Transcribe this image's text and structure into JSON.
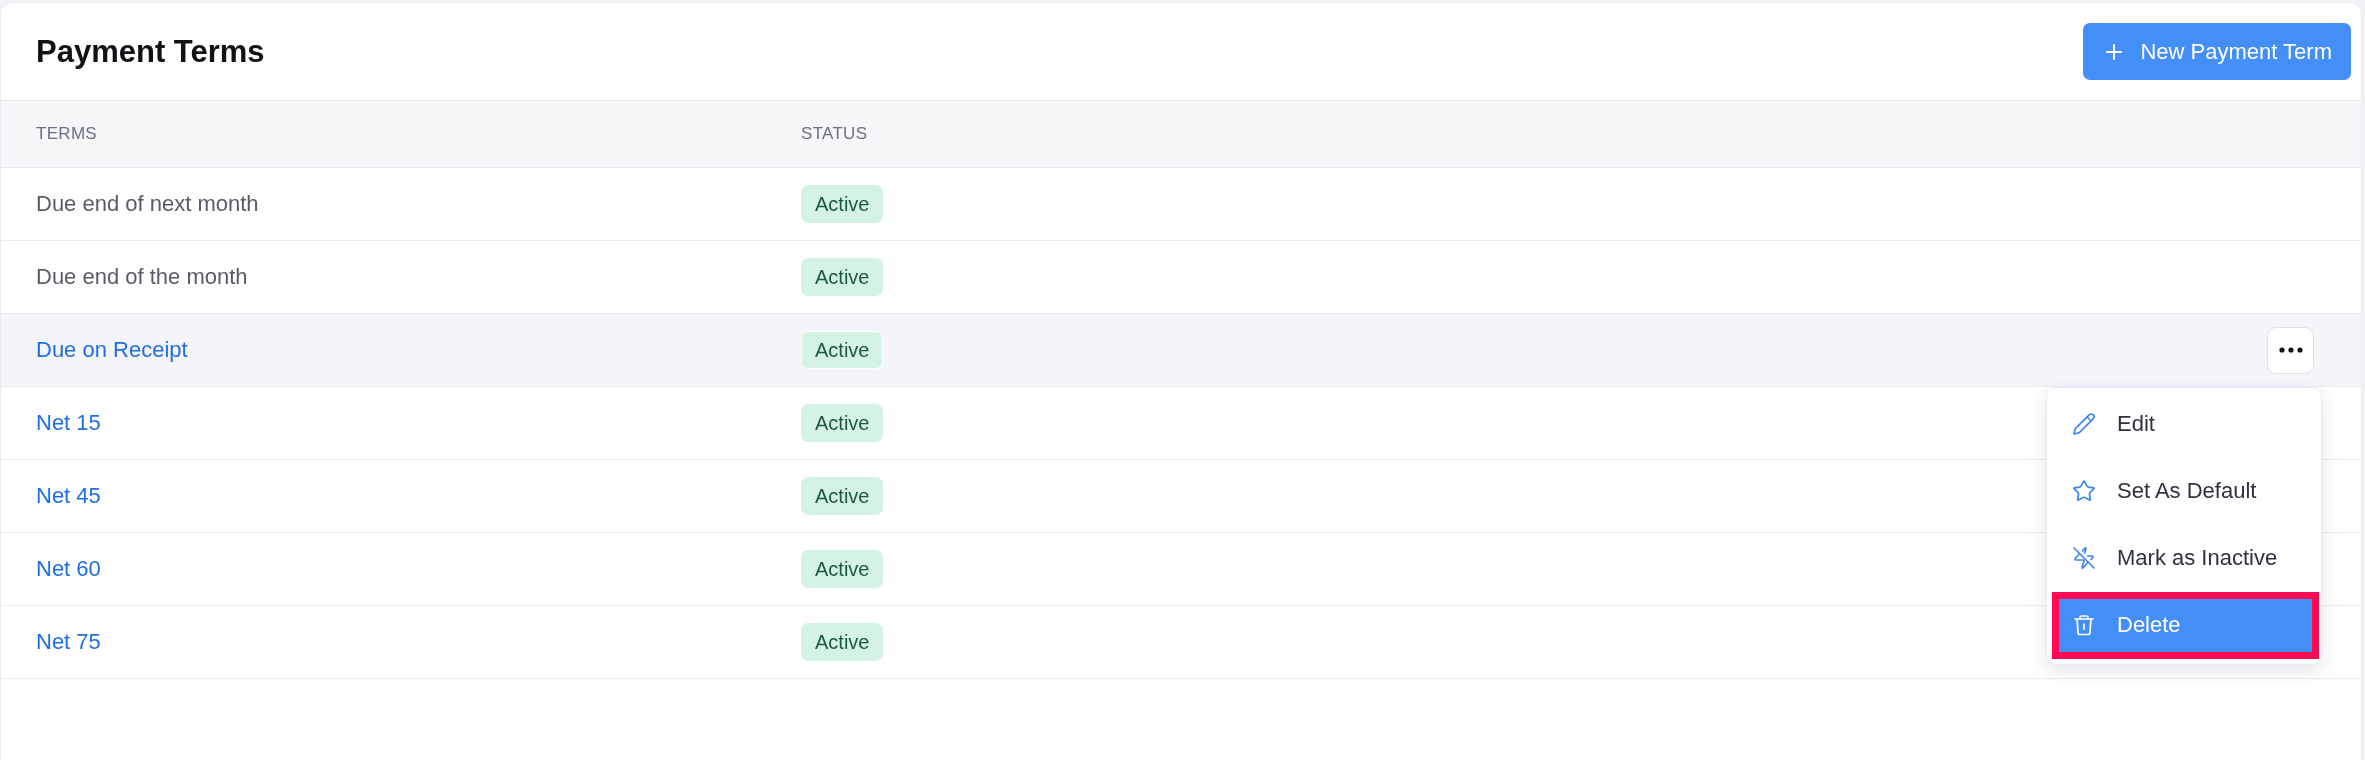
{
  "page": {
    "title": "Payment Terms"
  },
  "new_button": {
    "label": "New Payment Term"
  },
  "table": {
    "columns": [
      "TERMS",
      "STATUS"
    ],
    "rows": [
      {
        "term": "Due end of next month",
        "kind": "plain",
        "status": "Active",
        "selected": false
      },
      {
        "term": "Due end of the month",
        "kind": "plain",
        "status": "Active",
        "selected": false
      },
      {
        "term": "Due on Receipt",
        "kind": "link",
        "status": "Active",
        "selected": true
      },
      {
        "term": "Net 15",
        "kind": "link",
        "status": "Active",
        "selected": false
      },
      {
        "term": "Net 45",
        "kind": "link",
        "status": "Active",
        "selected": false
      },
      {
        "term": "Net 60",
        "kind": "link",
        "status": "Active",
        "selected": false
      },
      {
        "term": "Net 75",
        "kind": "link",
        "status": "Active",
        "selected": false
      }
    ]
  },
  "row_menu": {
    "items": [
      {
        "label": "Edit",
        "kind": "edit",
        "selected": false,
        "outlined": false
      },
      {
        "label": "Set As Default",
        "kind": "default",
        "selected": false,
        "outlined": false
      },
      {
        "label": "Mark as Inactive",
        "kind": "inactive",
        "selected": false,
        "outlined": false
      },
      {
        "label": "Delete",
        "kind": "delete",
        "selected": true,
        "outlined": true
      }
    ]
  }
}
